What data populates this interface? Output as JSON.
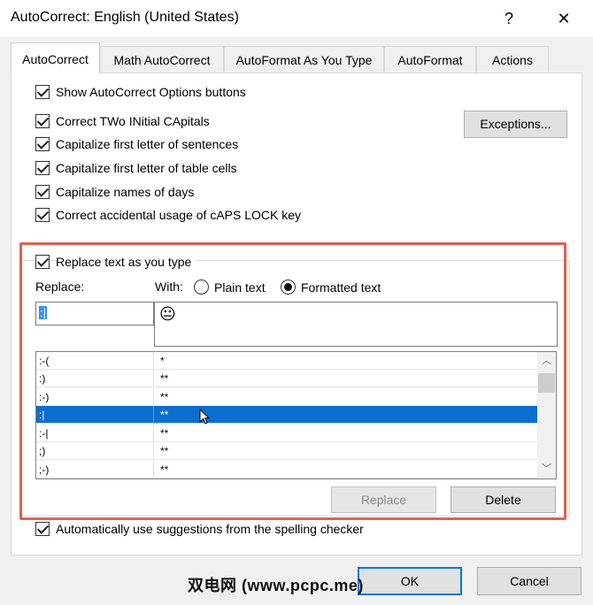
{
  "window": {
    "title": "AutoCorrect: English (United States)",
    "help": "?",
    "close": "✕"
  },
  "tabs": [
    {
      "label": "AutoCorrect",
      "active": true
    },
    {
      "label": "Math AutoCorrect",
      "active": false
    },
    {
      "label": "AutoFormat As You Type",
      "active": false
    },
    {
      "label": "AutoFormat",
      "active": false
    },
    {
      "label": "Actions",
      "active": false
    }
  ],
  "options": {
    "show_buttons": "Show AutoCorrect Options buttons",
    "two_initial": "Correct TWo INitial CApitals",
    "first_sentence": "Capitalize first letter of sentences",
    "table_cells": "Capitalize first letter of table cells",
    "days": "Capitalize names of days",
    "caps_lock": "Correct accidental usage of cAPS LOCK key"
  },
  "exceptions_button": "Exceptions...",
  "replace_section": {
    "checkbox": "Replace text as you type",
    "replace_label": "Replace:",
    "with_label": "With:",
    "plain_text": "Plain text",
    "formatted_text": "Formatted text",
    "formatted_selected": true,
    "replace_value": ":|",
    "with_value_emoji": "😐"
  },
  "entries": [
    {
      "replace": ":-(",
      "with": "*"
    },
    {
      "replace": ":)",
      "with": "**"
    },
    {
      "replace": ":-)",
      "with": "**"
    },
    {
      "replace": ":|",
      "with": "**",
      "selected": true
    },
    {
      "replace": ":-|",
      "with": "**"
    },
    {
      "replace": ";)",
      "with": "**"
    },
    {
      "replace": ";-)",
      "with": "**"
    }
  ],
  "buttons": {
    "replace": "Replace",
    "delete": "Delete",
    "ok": "OK",
    "cancel": "Cancel"
  },
  "spelling_option": "Automatically use suggestions from the spelling checker",
  "watermark": "双电网 (www.pcpc.me)",
  "colors": {
    "selection": "#0d6ed0",
    "highlight_border": "#e06150",
    "ok_border": "#0078d7"
  }
}
